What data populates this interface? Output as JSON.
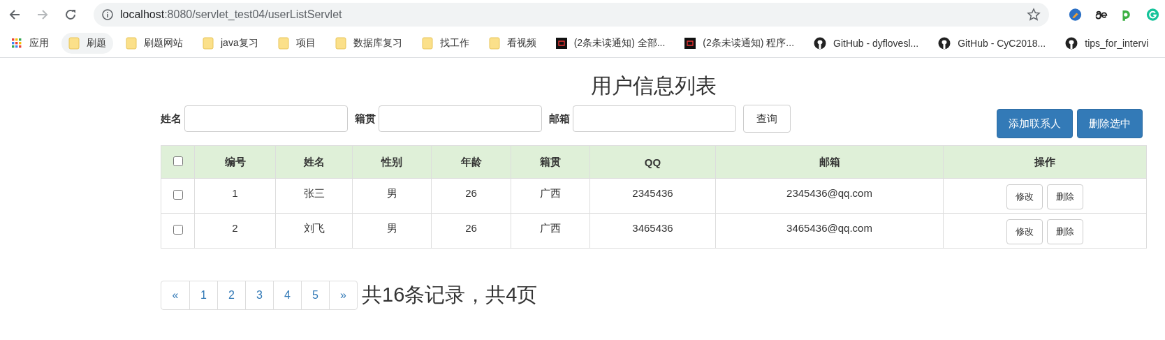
{
  "browser": {
    "url_host": "localhost",
    "url_rest": ":8080/servlet_test04/userListServlet",
    "bookmarks": [
      {
        "kind": "apps",
        "label": "应用"
      },
      {
        "kind": "folder",
        "label": "刷题",
        "selected": true
      },
      {
        "kind": "folder",
        "label": "刷题网站",
        "selected": false
      },
      {
        "kind": "folder",
        "label": "java复习",
        "selected": false
      },
      {
        "kind": "folder",
        "label": "项目",
        "selected": false
      },
      {
        "kind": "folder",
        "label": "数据库复习",
        "selected": false
      },
      {
        "kind": "folder",
        "label": "找工作",
        "selected": false
      },
      {
        "kind": "folder",
        "label": "看视频",
        "selected": false
      },
      {
        "kind": "site",
        "label": "(2条未读通知) 全部..."
      },
      {
        "kind": "site",
        "label": "(2条未读通知) 程序..."
      },
      {
        "kind": "github",
        "label": "GitHub - dyflovesl..."
      },
      {
        "kind": "github",
        "label": "GitHub - CyC2018..."
      },
      {
        "kind": "github",
        "label": "tips_for_intervi"
      }
    ]
  },
  "page": {
    "title": "用户信息列表",
    "filters": [
      {
        "label": "姓名"
      },
      {
        "label": "籍贯"
      },
      {
        "label": "邮箱"
      }
    ],
    "search_button": "查询",
    "actions": [
      "添加联系人",
      "删除选中"
    ],
    "table": {
      "columns": [
        "编号",
        "姓名",
        "性别",
        "年龄",
        "籍贯",
        "QQ",
        "邮箱",
        "操作"
      ],
      "header_checked": false,
      "rows": [
        {
          "checked": false,
          "cells": [
            "1",
            "张三",
            "男",
            "26",
            "广西",
            "2345436",
            "2345436@qq.com"
          ],
          "buttons": [
            "修改",
            "删除"
          ]
        },
        {
          "checked": false,
          "cells": [
            "2",
            "刘飞",
            "男",
            "26",
            "广西",
            "3465436",
            "3465436@qq.com"
          ],
          "buttons": [
            "修改",
            "删除"
          ]
        }
      ]
    },
    "pagination": {
      "prev": "«",
      "pages": [
        "1",
        "2",
        "3",
        "4",
        "5"
      ],
      "next": "»"
    },
    "summary": "共16条记录，共4页"
  }
}
